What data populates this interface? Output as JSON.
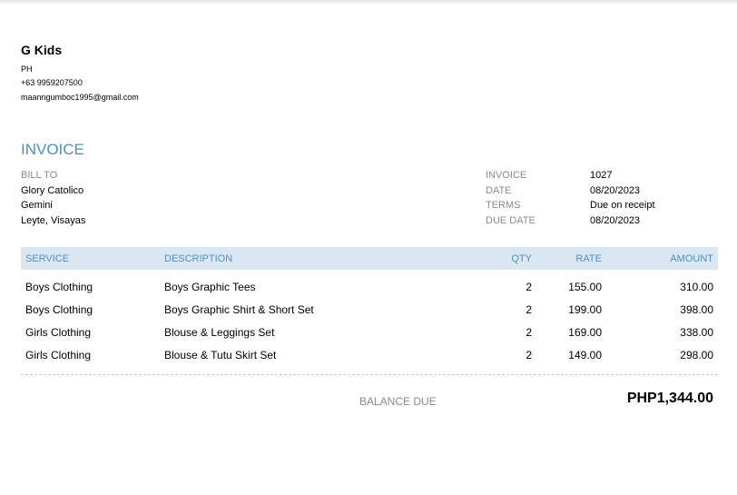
{
  "company": {
    "name": "G Kids",
    "country": "PH",
    "phone": "+63 9959207500",
    "email": "maanngumboc1995@gmail.com"
  },
  "invoice": {
    "title": "INVOICE",
    "bill_to_label": "BILL TO",
    "bill_to": [
      "Glory Catolico",
      "Gemini",
      "Leyte, Visayas"
    ],
    "meta": [
      {
        "label": "INVOICE",
        "value": "1027"
      },
      {
        "label": "DATE",
        "value": "08/20/2023"
      },
      {
        "label": "TERMS",
        "value": "Due on receipt"
      },
      {
        "label": "DUE DATE",
        "value": "08/20/2023"
      }
    ]
  },
  "table": {
    "headers": {
      "service": "SERVICE",
      "description": "DESCRIPTION",
      "qty": "QTY",
      "rate": "RATE",
      "amount": "AMOUNT"
    },
    "rows": [
      {
        "service": "Boys Clothing",
        "description": "Boys Graphic Tees",
        "qty": "2",
        "rate": "155.00",
        "amount": "310.00"
      },
      {
        "service": "Boys Clothing",
        "description": "Boys Graphic Shirt & Short Set",
        "qty": "2",
        "rate": "199.00",
        "amount": "398.00"
      },
      {
        "service": "Girls Clothing",
        "description": "Blouse & Leggings Set",
        "qty": "2",
        "rate": "169.00",
        "amount": "338.00"
      },
      {
        "service": "Girls Clothing",
        "description": "Blouse & Tutu Skirt Set",
        "qty": "2",
        "rate": "149.00",
        "amount": "298.00"
      }
    ]
  },
  "balance": {
    "label": "BALANCE DUE",
    "value": "PHP1,344.00"
  },
  "colors": {
    "accent": "#4a90c0",
    "header_bg": "#dce8f1",
    "label_gray": "#8a8a8a"
  }
}
